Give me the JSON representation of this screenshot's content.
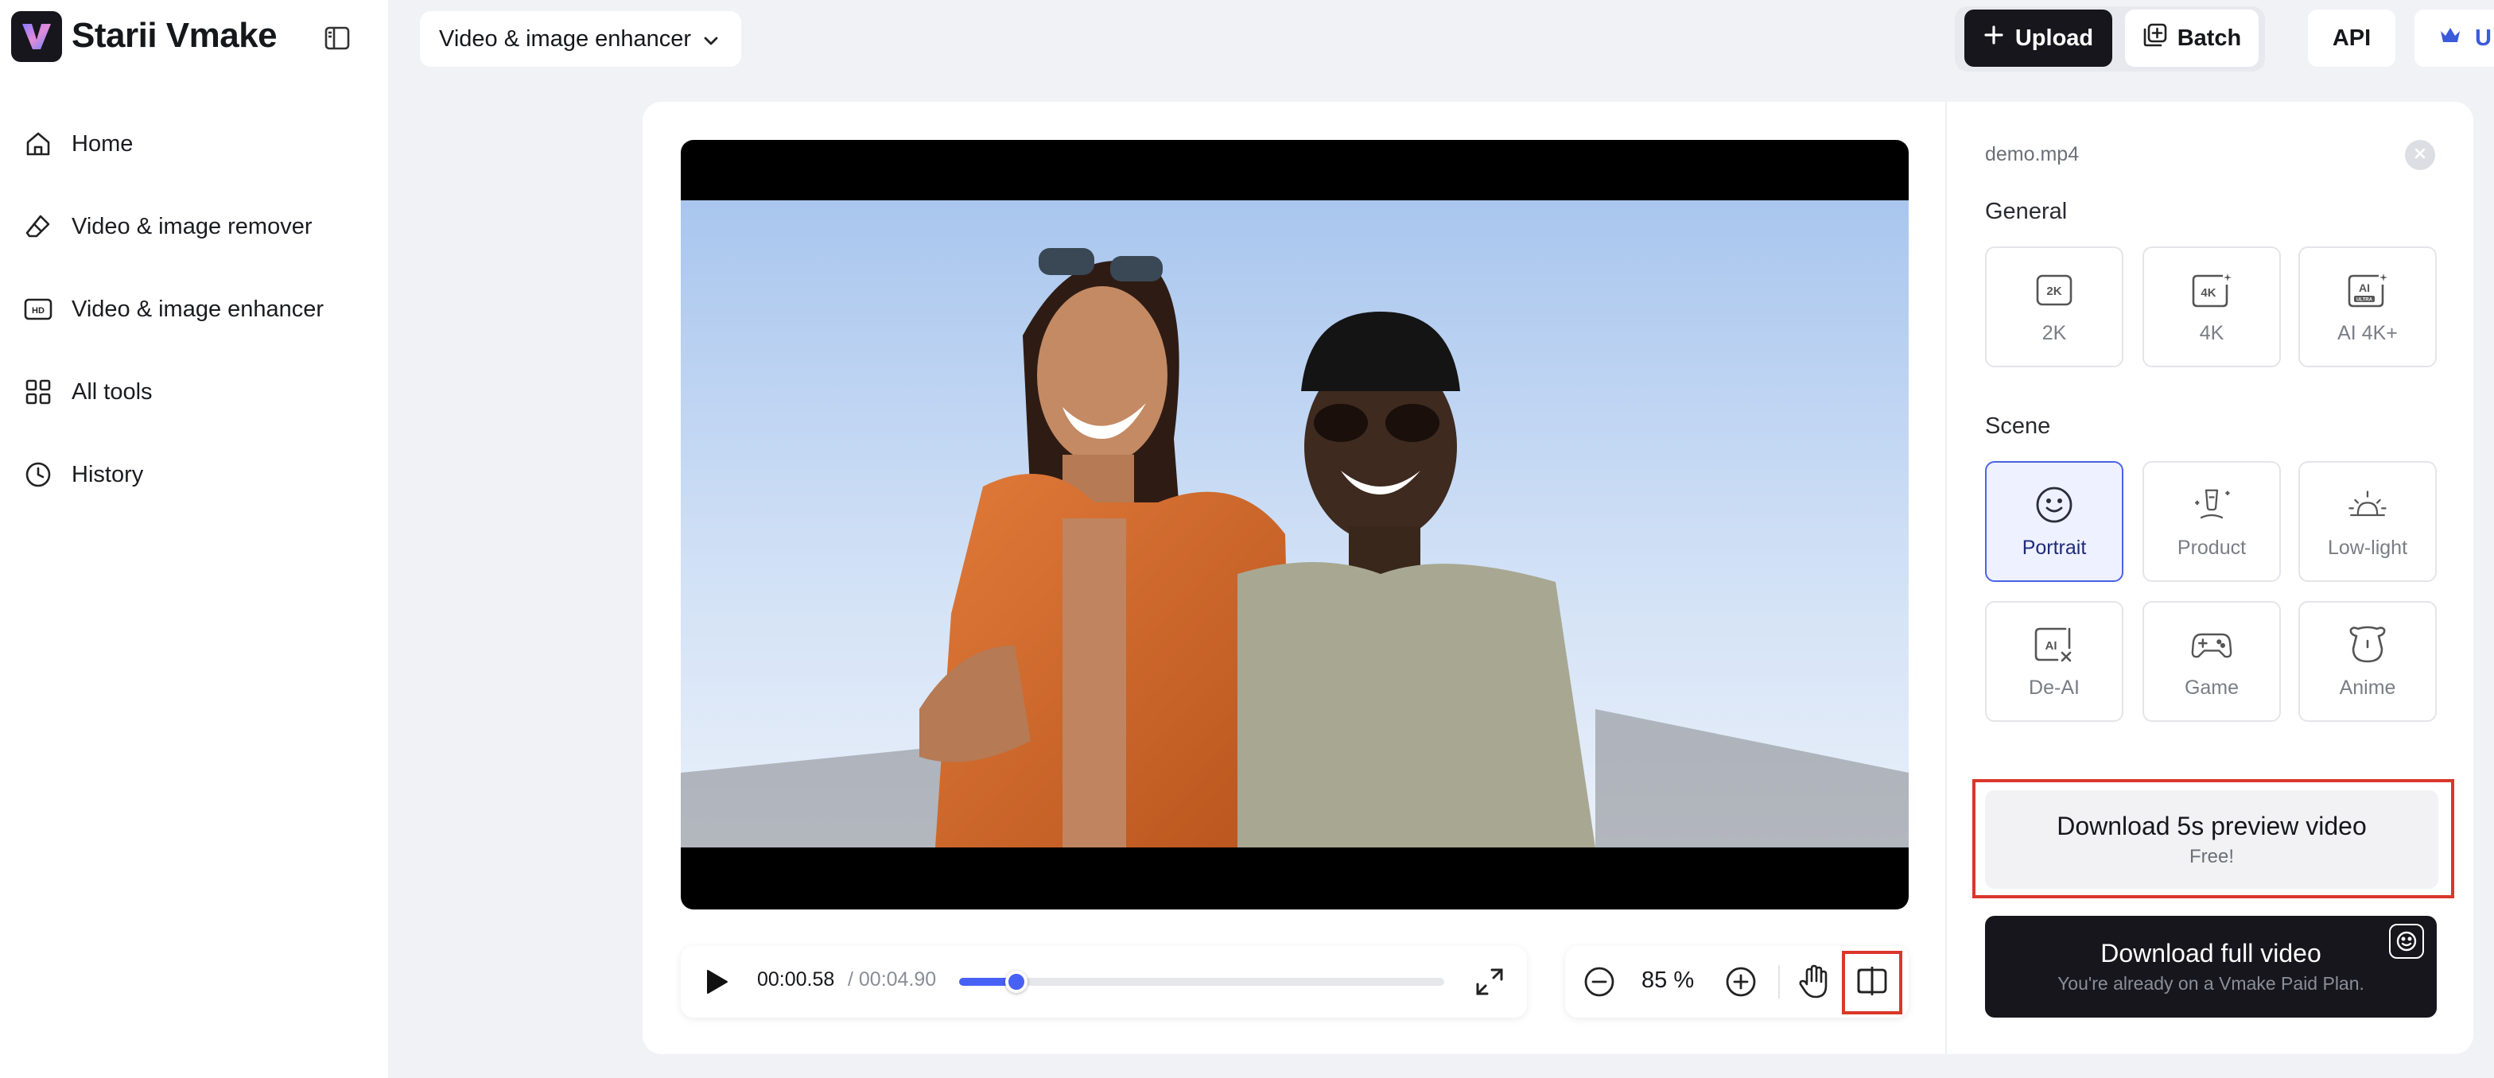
{
  "app": {
    "title": "Starii Vmake"
  },
  "sidebar": {
    "items": [
      {
        "label": "Home",
        "icon": "home-icon"
      },
      {
        "label": "Video & image remover",
        "icon": "eraser-icon"
      },
      {
        "label": "Video & image enhancer",
        "icon": "hd-icon"
      },
      {
        "label": "All tools",
        "icon": "grid-icon"
      },
      {
        "label": "History",
        "icon": "clock-icon"
      }
    ]
  },
  "topbar": {
    "mode_select": "Video & image enhancer",
    "upload_label": "Upload",
    "batch_label": "Batch",
    "api_label": "API",
    "user_label": "U"
  },
  "player": {
    "current_time": "00:00.58",
    "total_time": "/ 00:04.90",
    "progress": 0.118,
    "zoom": "85 %"
  },
  "panel": {
    "file_name": "demo.mp4",
    "general_title": "General",
    "general_options": [
      {
        "label": "2K",
        "icon": "2k-icon"
      },
      {
        "label": "4K",
        "icon": "4k-icon"
      },
      {
        "label": "AI 4K+",
        "icon": "ai-ultra-icon"
      }
    ],
    "scene_title": "Scene",
    "scene_options": [
      {
        "label": "Portrait",
        "icon": "smiley-icon",
        "selected": true
      },
      {
        "label": "Product",
        "icon": "product-icon",
        "selected": false
      },
      {
        "label": "Low-light",
        "icon": "sunrise-icon",
        "selected": false
      },
      {
        "label": "De-AI",
        "icon": "de-ai-icon",
        "selected": false
      },
      {
        "label": "Game",
        "icon": "gamepad-icon",
        "selected": false
      },
      {
        "label": "Anime",
        "icon": "bear-icon",
        "selected": false
      }
    ],
    "download_preview": {
      "title": "Download 5s preview video",
      "subtitle": "Free!"
    },
    "download_full": {
      "title": "Download full video",
      "subtitle": "You're already on a Vmake Paid Plan."
    }
  },
  "colors": {
    "accent": "#4761f5",
    "dark": "#17161d",
    "highlight": "#d9372a"
  }
}
